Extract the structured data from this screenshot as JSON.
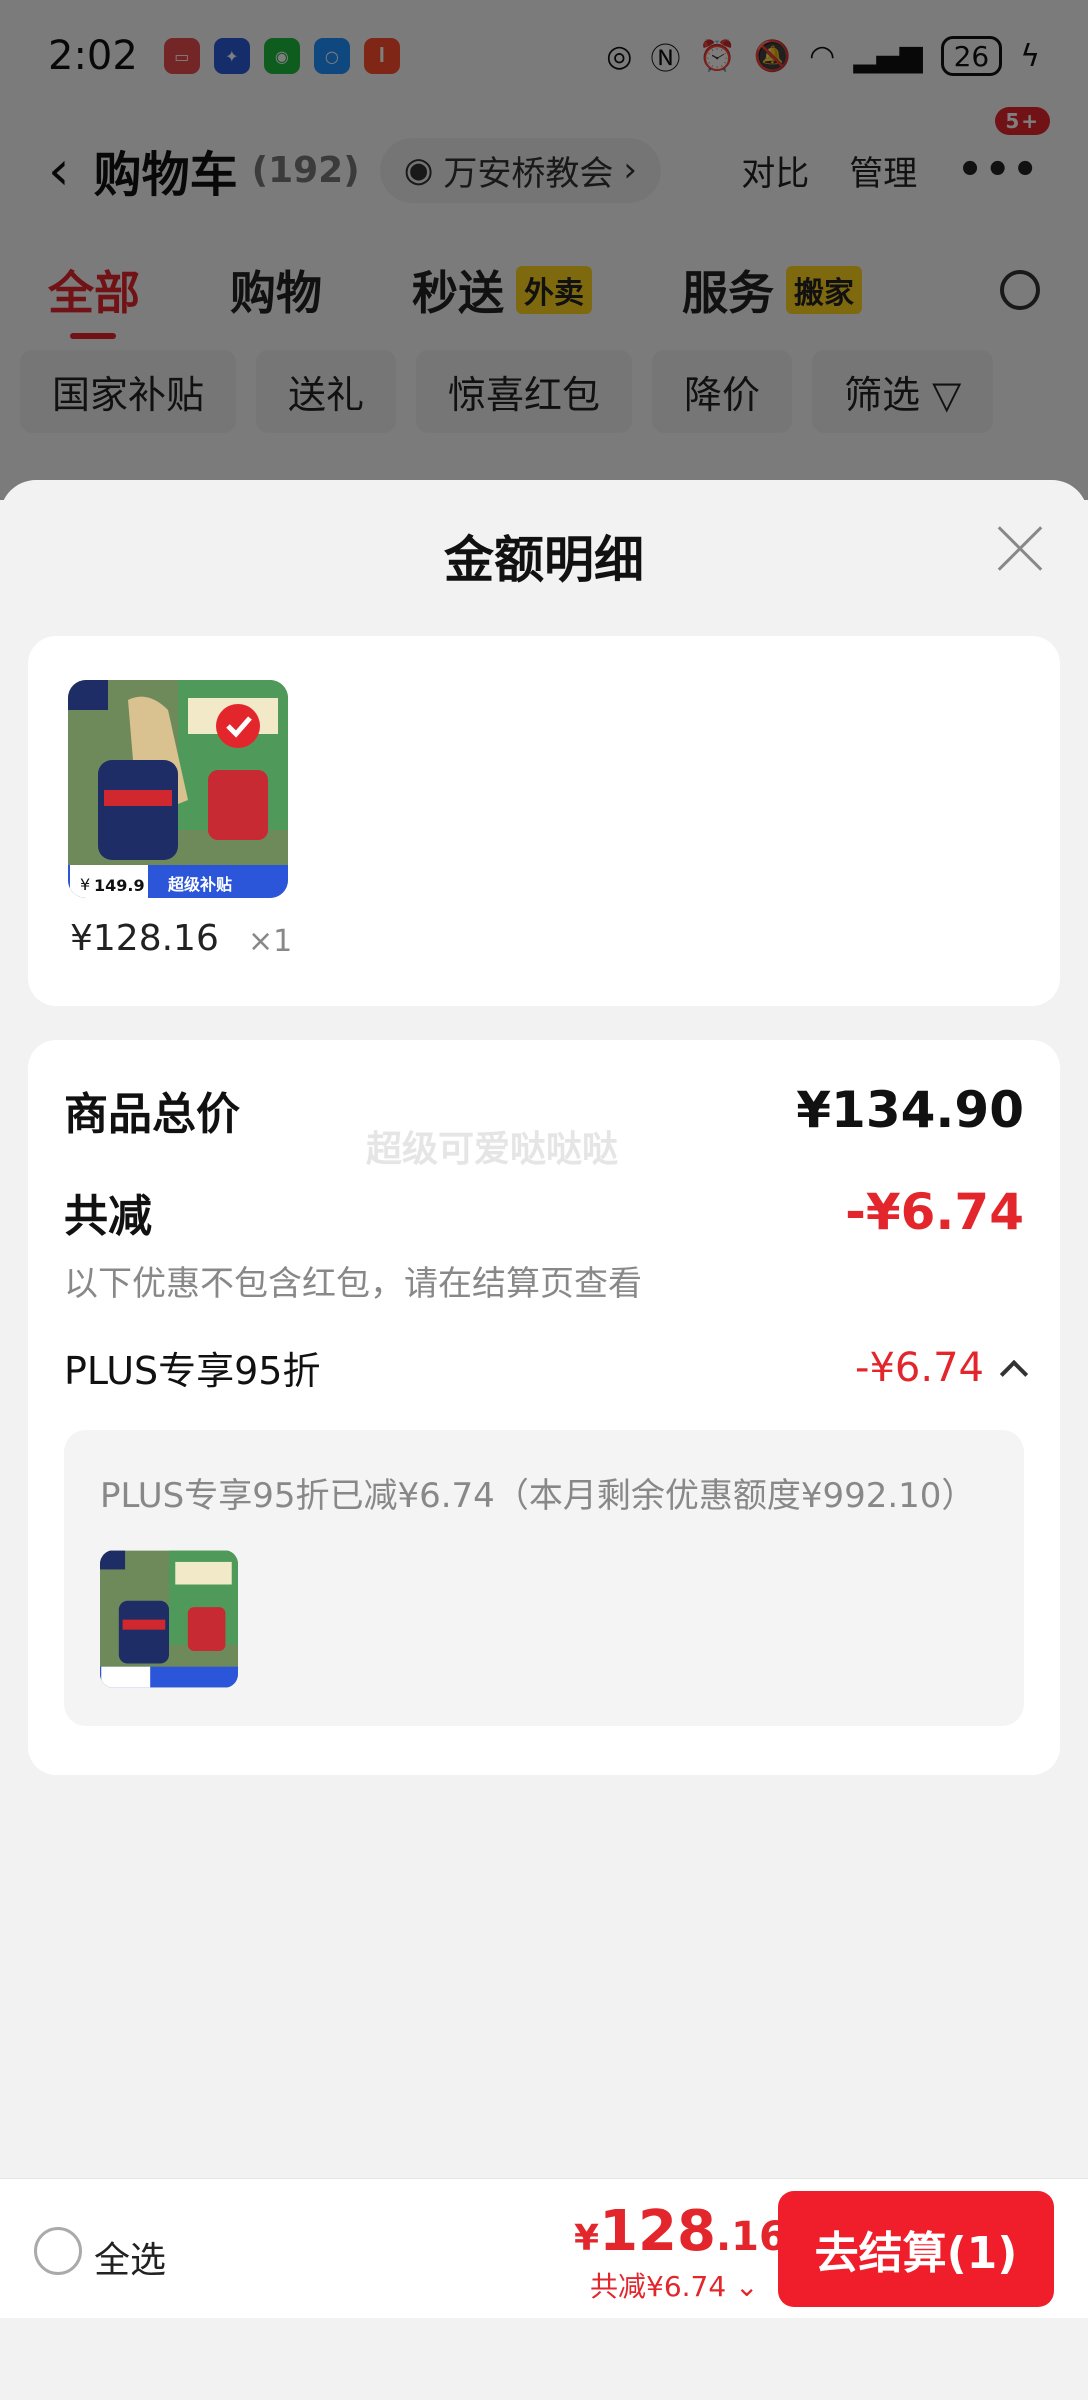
{
  "status_bar": {
    "time": "2:02",
    "battery": "26"
  },
  "nav": {
    "back": "‹",
    "title": "购物车",
    "count": "(192)",
    "location": "万安桥教会",
    "compare": "对比",
    "manage": "管理",
    "more": "•••",
    "badge": "5+"
  },
  "tabs": [
    {
      "label": "全部",
      "tag": ""
    },
    {
      "label": "购物",
      "tag": ""
    },
    {
      "label": "秒送",
      "tag": "外卖"
    },
    {
      "label": "服务",
      "tag": "搬家"
    }
  ],
  "chips": [
    "国家补贴",
    "送礼",
    "惊喜红包",
    "降价",
    "筛选"
  ],
  "sheet": {
    "title": "金额明细",
    "product": {
      "price": "¥128.16",
      "qty": "×1",
      "img_price": "149.9",
      "img_tag": "超级补贴"
    },
    "summary": {
      "total_label": "商品总价",
      "total_value": "¥134.90",
      "reduce_label": "共减",
      "reduce_value": "-¥6.74",
      "note": "以下优惠不包含红包，请在结算页查看",
      "plus_label": "PLUS专享95折",
      "plus_value": "-¥6.74",
      "watermark": "超级可爱哒哒哒",
      "detail_text": "PLUS专享95折已减¥6.74（本月剩余优惠额度¥992.10）"
    }
  },
  "bottom": {
    "select_all": "全选",
    "yen": "¥",
    "price_int": "128",
    "price_dec": ".16",
    "saved": "共减¥6.74 ⌄",
    "checkout": "去结算(1)"
  },
  "colors": {
    "accent_red": "#e3262c",
    "checkout_red": "#f01d2a"
  }
}
